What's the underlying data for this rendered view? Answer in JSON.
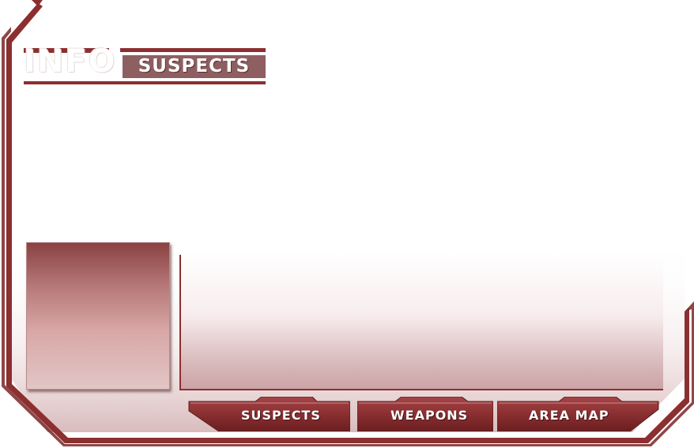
{
  "header": {
    "title": "INFO",
    "section": "SUSPECTS"
  },
  "tabs": [
    {
      "label": "SUSPECTS"
    },
    {
      "label": "WEAPONS"
    },
    {
      "label": "AREA MAP"
    }
  ],
  "colors": {
    "frame": "#8c2f30",
    "frame_dark": "#6e2021",
    "section_badge": "#8e5f61",
    "tab_fill": "#8a3234"
  }
}
